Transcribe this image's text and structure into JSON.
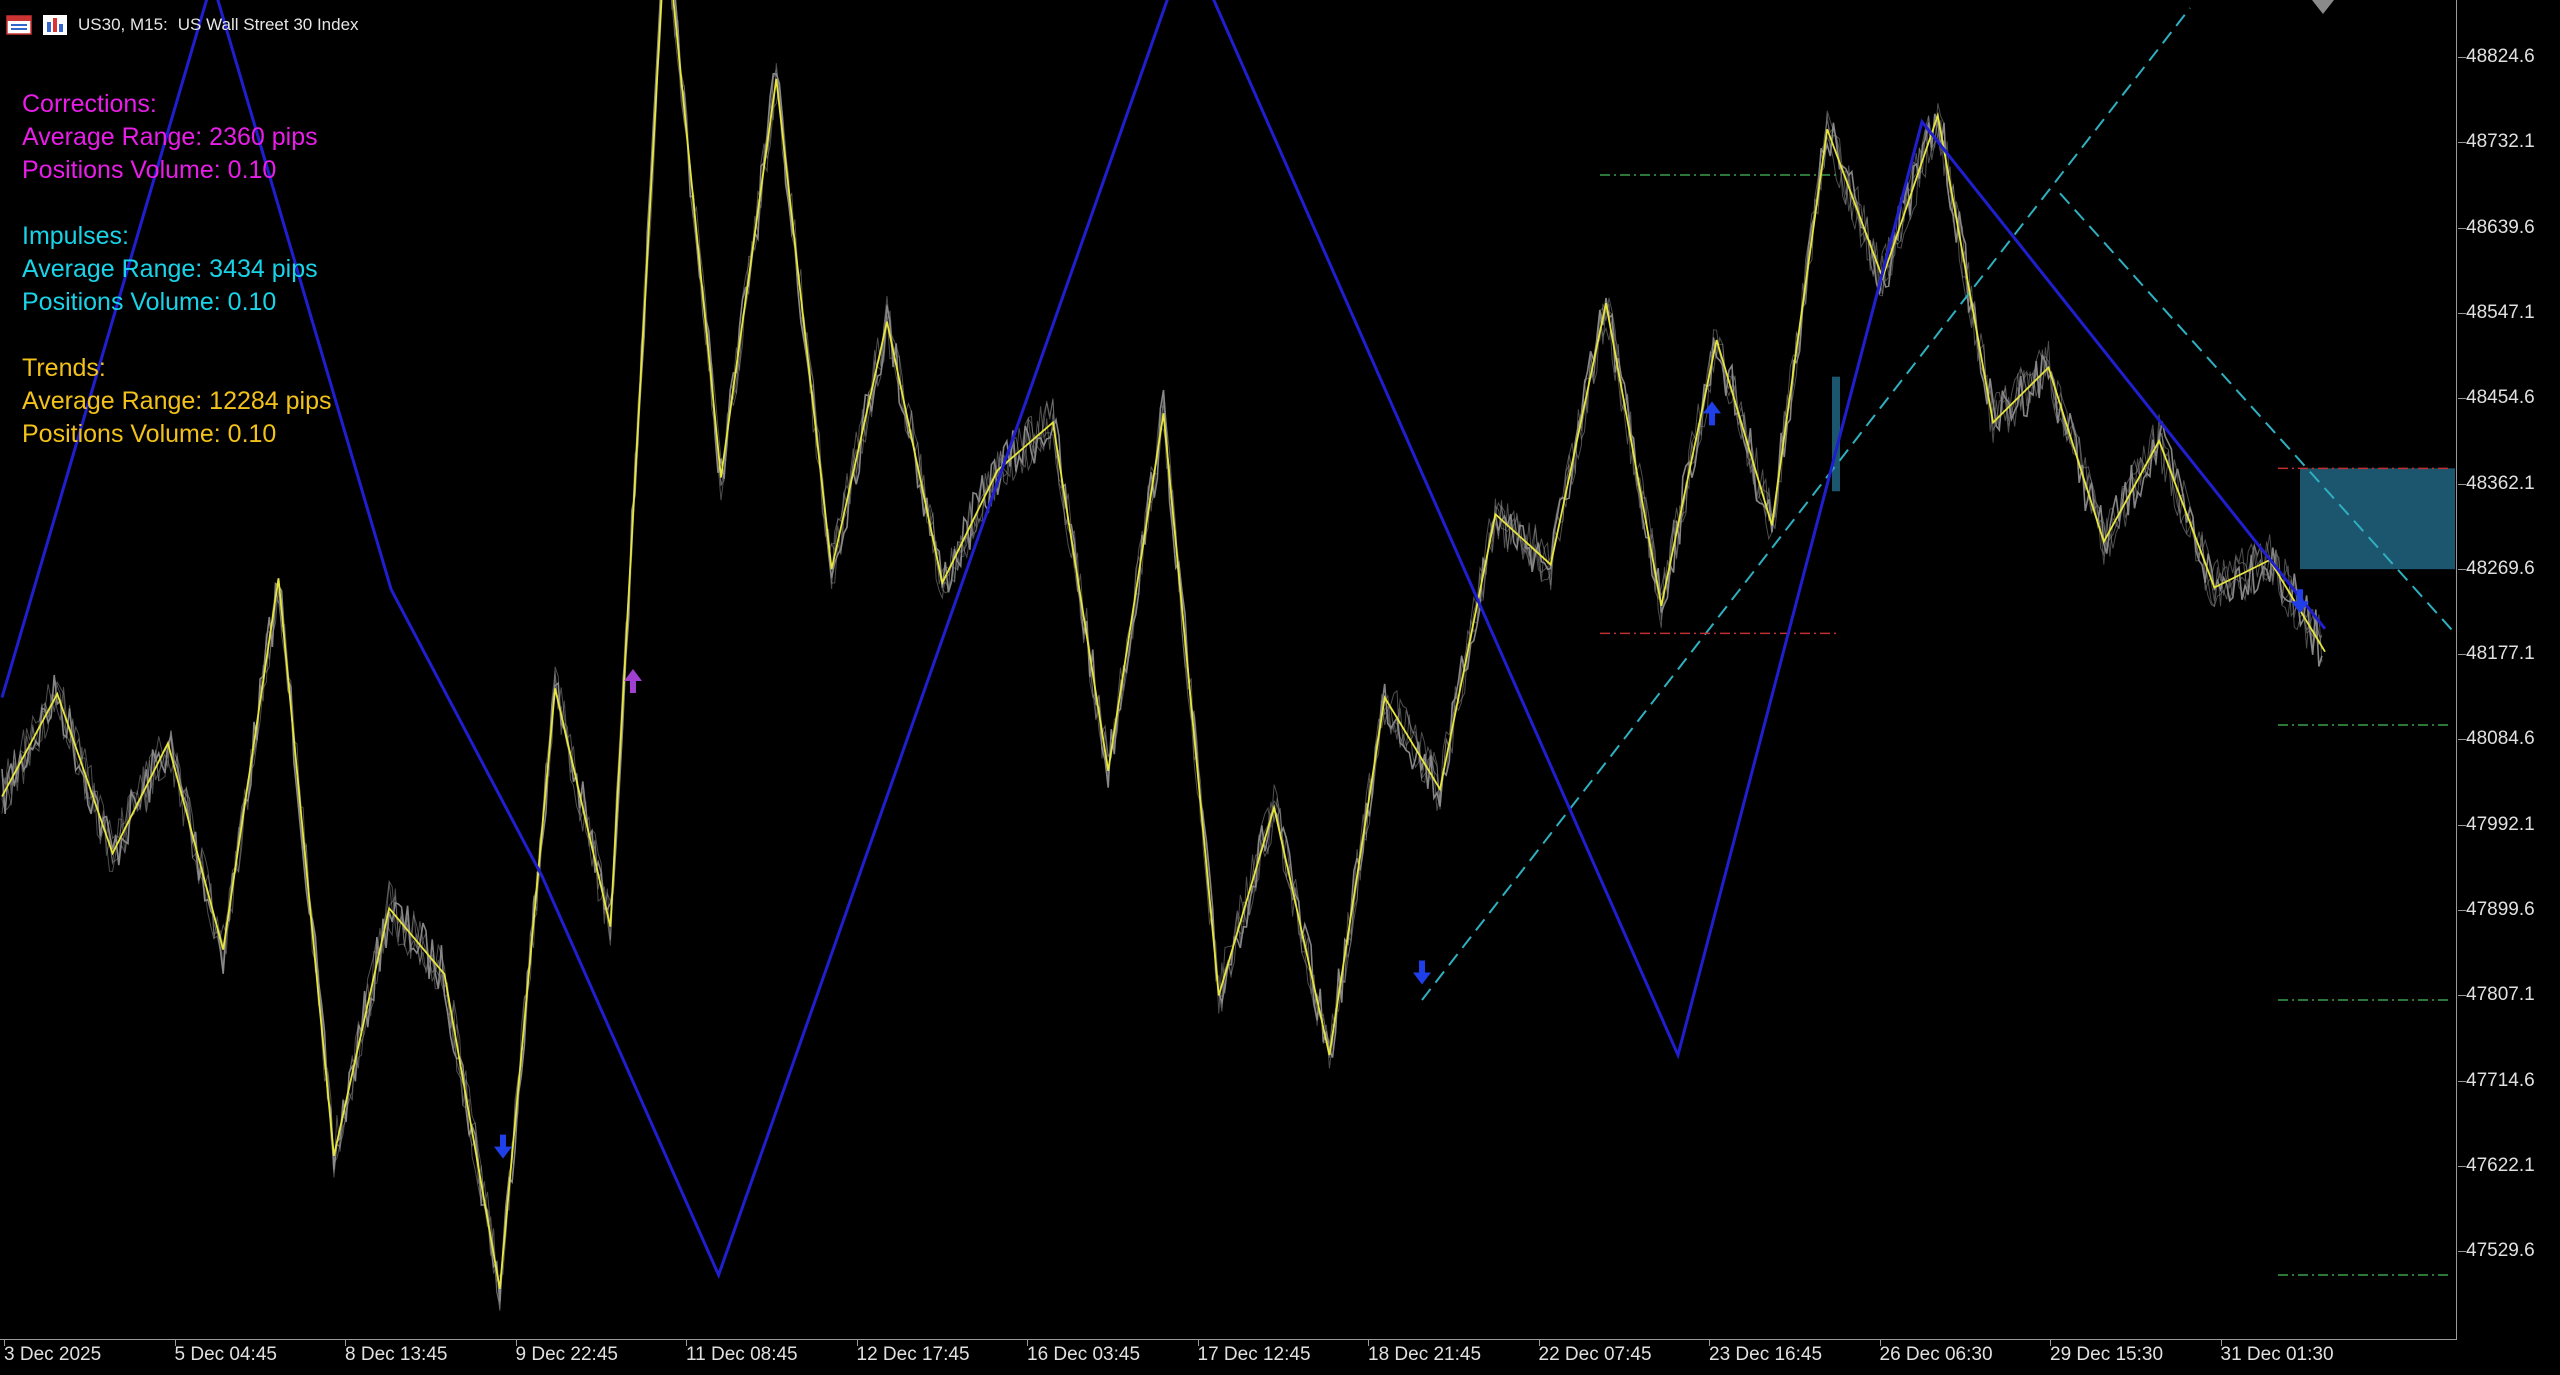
{
  "window": {
    "title_symbol": "US30, M15:",
    "title_desc": "US Wall Street 30 Index"
  },
  "stats": {
    "corrections": {
      "heading": "Corrections:",
      "range": "Average Range: 2360 pips",
      "volume": "Positions Volume: 0.10",
      "color": "#e81ee8"
    },
    "impulses": {
      "heading": "Impulses:",
      "range": "Average Range: 3434 pips",
      "volume": "Positions Volume: 0.10",
      "color": "#19d4e8"
    },
    "trends": {
      "heading": "Trends:",
      "range": "Average Range: 12284 pips",
      "volume": "Positions Volume: 0.10",
      "color": "#f2c21a"
    }
  },
  "price_axis": {
    "labels": [
      "48824.6",
      "48732.1",
      "48639.6",
      "48547.1",
      "48454.6",
      "48362.1",
      "48269.6",
      "48177.1",
      "48084.6",
      "47992.1",
      "47899.6",
      "47807.1",
      "47714.6",
      "47622.1",
      "47529.6"
    ]
  },
  "time_axis": {
    "labels": [
      "3 Dec 2025",
      "5 Dec 04:45",
      "8 Dec 13:45",
      "9 Dec 22:45",
      "11 Dec 08:45",
      "12 Dec 17:45",
      "16 Dec 03:45",
      "17 Dec 12:45",
      "18 Dec 21:45",
      "22 Dec 07:45",
      "23 Dec 16:45",
      "26 Dec 06:30",
      "29 Dec 15:30",
      "31 Dec 01:30"
    ]
  },
  "colors": {
    "background": "#000000",
    "trend_line": "#1f1fd0",
    "zigzag": "#e8e63a",
    "price": "#8c8c8c",
    "channel": "#2fb0c0",
    "box": "#1f5f7a",
    "arrow_down": "#1f3fe8",
    "arrow_up_purple": "#a040d0"
  },
  "chart_data": {
    "type": "line",
    "symbol": "US30",
    "timeframe": "M15",
    "trend_pivots": [
      48130,
      48912,
      48248,
      47935,
      47500,
      48955,
      47740,
      48758,
      48205
    ],
    "zigzag_pivots": [
      48022,
      48134,
      47960,
      48080,
      47855,
      48260,
      47630,
      47900,
      47828,
      47485,
      48140,
      47880,
      48975,
      48370,
      48805,
      48270,
      48540,
      48255,
      48378,
      48430,
      48050,
      48440,
      47805,
      48010,
      47740,
      48130,
      48030,
      48330,
      48275,
      48560,
      48230,
      48520,
      48318,
      48750,
      48588,
      48765,
      48430,
      48490,
      48300,
      48410,
      48250,
      48280,
      48180
    ],
    "ylim": [
      47440,
      48880
    ]
  }
}
